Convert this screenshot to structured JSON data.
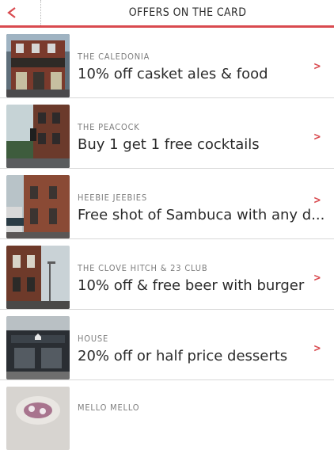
{
  "header": {
    "title": "OFFERS ON THE CARD",
    "back_icon": "chevron-left-icon",
    "accent": "#d94a4f"
  },
  "offers": [
    {
      "venue": "THE CALEDONIA",
      "offer": "10% off casket ales & food",
      "chevron": ">"
    },
    {
      "venue": "THE PEACOCK",
      "offer": "Buy 1 get 1 free cocktails",
      "chevron": ">"
    },
    {
      "venue": "HEEBIE JEEBIES",
      "offer": "Free shot of Sambuca with any d...",
      "chevron": ">"
    },
    {
      "venue": "THE CLOVE HITCH & 23 CLUB",
      "offer": "10% off & free beer with burger",
      "chevron": ">"
    },
    {
      "venue": "HOUSE",
      "offer": "20% off or half price desserts",
      "chevron": ">"
    },
    {
      "venue": "MELLO MELLO",
      "offer": "",
      "chevron": ""
    }
  ]
}
